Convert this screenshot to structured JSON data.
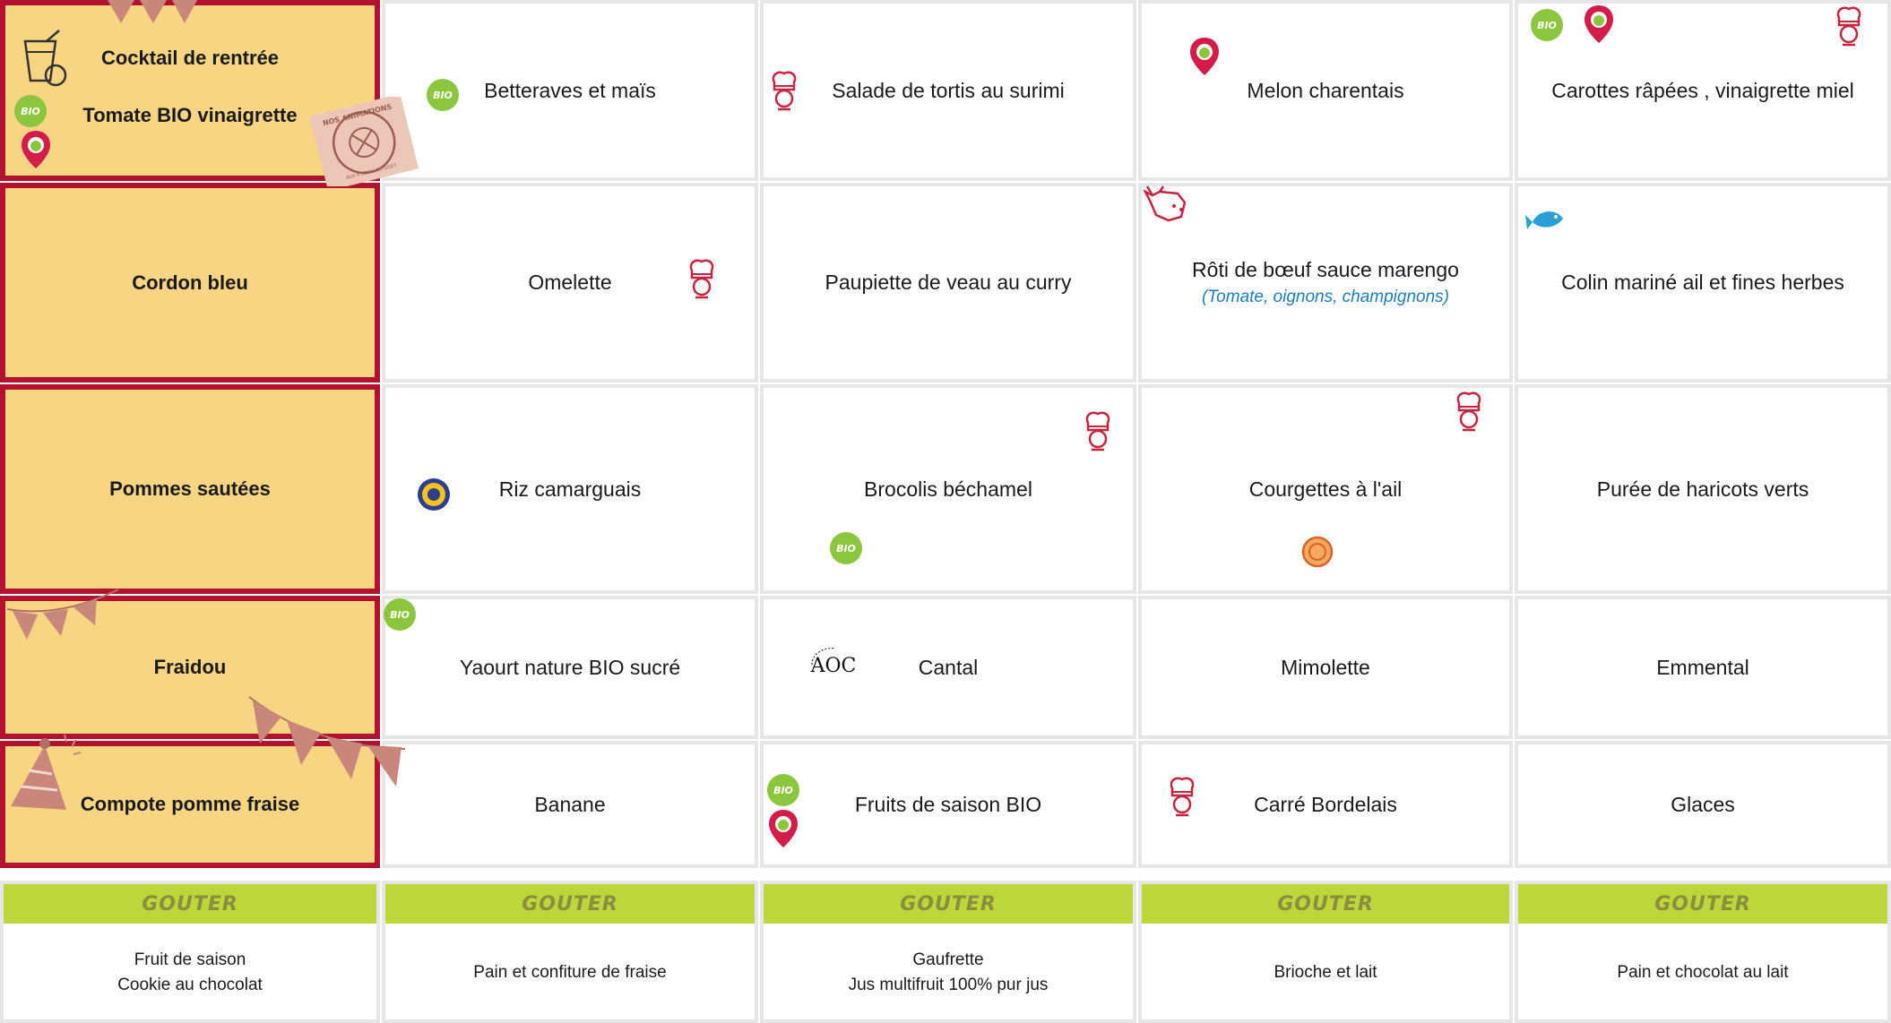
{
  "menu": {
    "featured": {
      "starter_1": "Cocktail de rentrée",
      "starter_2": "Tomate BIO vinaigrette",
      "main": "Cordon bleu",
      "side": "Pommes sautées",
      "dairy": "Fraidou",
      "dessert": "Compote pomme fraise"
    },
    "col2": {
      "starter": "Betteraves et maïs",
      "main": "Omelette",
      "side": "Riz camarguais",
      "dairy": "Yaourt nature BIO sucré",
      "dessert": "Banane"
    },
    "col3": {
      "starter": "Salade de tortis au surimi",
      "main": "Paupiette de veau au curry",
      "side": "Brocolis béchamel",
      "dairy": "Cantal",
      "dessert": "Fruits de saison BIO"
    },
    "col4": {
      "starter": "Melon charentais",
      "main": "Rôti de bœuf sauce marengo",
      "main_note": "(Tomate, oignons, champignons)",
      "side": "Courgettes à l'ail",
      "dairy": "Mimolette",
      "dessert": "Carré Bordelais"
    },
    "col5": {
      "starter": "Carottes râpées , vinaigrette miel",
      "main": "Colin mariné ail et fines herbes",
      "side": "Purée de haricots verts",
      "dairy": "Emmental",
      "dessert": "Glaces"
    }
  },
  "snack": {
    "label": "GOUTER",
    "days": [
      {
        "line1": "Fruit de saison",
        "line2": "Cookie au chocolat"
      },
      {
        "line1": "Pain et confiture de fraise",
        "line2": ""
      },
      {
        "line1": "Gaufrette",
        "line2": "Jus multifruit 100% pur jus"
      },
      {
        "line1": "Brioche et lait",
        "line2": ""
      },
      {
        "line1": "Pain et chocolat au lait",
        "line2": ""
      }
    ]
  },
  "badges": {
    "bio": "BIO",
    "aoc": "AOC",
    "animations_stamp": "NOS ANIMATIONS",
    "animations_sub": "AUX 4 COINS DU GOÛT"
  },
  "colors": {
    "featured_bg": "#f8d582",
    "featured_border": "#b3122e",
    "snack_band": "#bdd63a",
    "bio_green": "#8cc63f",
    "pin_red": "#d41c4a",
    "chef_red": "#c8243f",
    "note_blue": "#1e7bc0"
  },
  "icons": [
    "bio-badge-icon",
    "local-pin-icon",
    "chef-hat-icon",
    "cow-icon",
    "fish-icon",
    "label-rouge-icon",
    "aoc-icon",
    "cocktail-icon",
    "party-hat-icon",
    "bunting-icon"
  ]
}
